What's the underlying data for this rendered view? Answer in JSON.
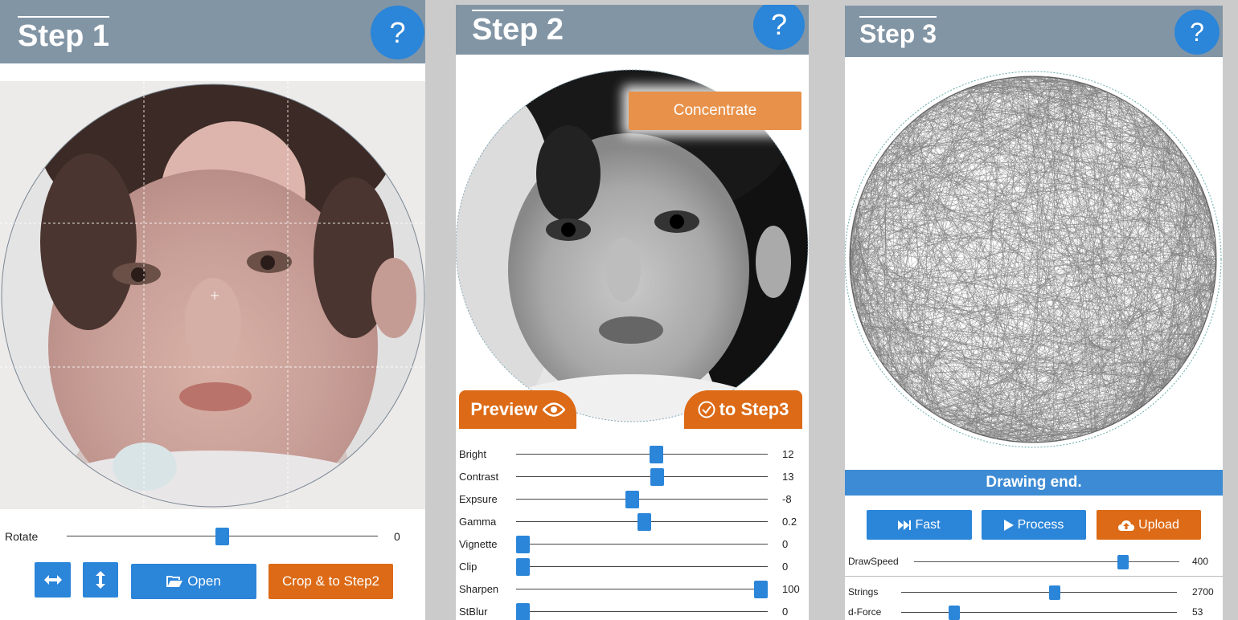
{
  "step1": {
    "title": "Step 1",
    "help_label": "?",
    "rotate": {
      "label": "Rotate",
      "value": "0",
      "fraction": 0.5
    },
    "buttons": {
      "open": "Open",
      "crop": "Crop & to Step2"
    }
  },
  "step2": {
    "title": "Step 2",
    "help_label": "?",
    "concentrate_label": "Concentrate",
    "preview_label": "Preview",
    "to_step3_label": "to Step3",
    "sliders": [
      {
        "label": "Bright",
        "value": "12",
        "fraction": 0.56
      },
      {
        "label": "Contrast",
        "value": "13",
        "fraction": 0.565
      },
      {
        "label": "Expsure",
        "value": "-8",
        "fraction": 0.46
      },
      {
        "label": "Gamma",
        "value": "0.2",
        "fraction": 0.51
      },
      {
        "label": "Vignette",
        "value": "0",
        "fraction": 0.0
      },
      {
        "label": "Clip",
        "value": "0",
        "fraction": 0.0
      },
      {
        "label": "Sharpen",
        "value": "100",
        "fraction": 1.0
      },
      {
        "label": "StBlur",
        "value": "0",
        "fraction": 0.0
      }
    ]
  },
  "step3": {
    "title": "Step 3",
    "help_label": "?",
    "status": "Drawing end.",
    "buttons": {
      "fast": "Fast",
      "process": "Process",
      "upload": "Upload"
    },
    "draw_speed": {
      "label": "DrawSpeed",
      "value": "400",
      "fraction": 0.8
    },
    "sliders": [
      {
        "label": "Strings",
        "value": "2700",
        "fraction": 0.56
      },
      {
        "label": "d-Force",
        "value": "53",
        "fraction": 0.18
      }
    ]
  },
  "colors": {
    "header": "#8295a5",
    "accent_blue": "#2b85d8",
    "accent_orange": "#dc6a16",
    "concentrate": "#e8914a"
  }
}
